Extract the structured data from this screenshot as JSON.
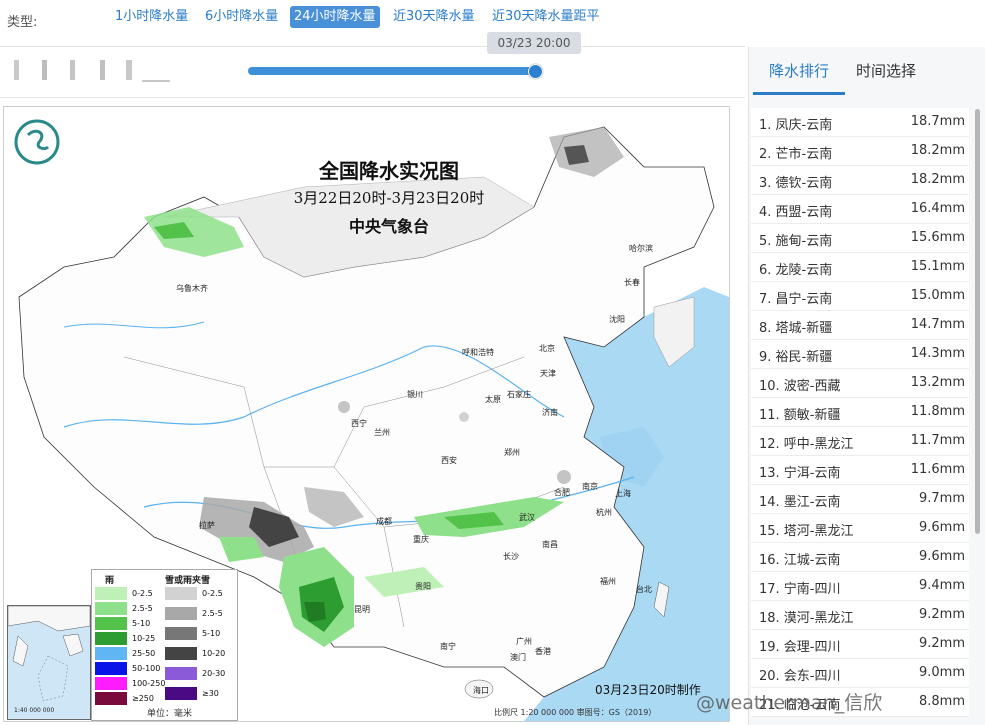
{
  "typebar": {
    "label": "类型:",
    "options": [
      {
        "label": "1小时降水量",
        "active": false
      },
      {
        "label": "6小时降水量",
        "active": false
      },
      {
        "label": "24小时降水量",
        "active": true
      },
      {
        "label": "近30天降水量",
        "active": false
      },
      {
        "label": "近30天降水量距平",
        "active": false
      }
    ]
  },
  "slider": {
    "time": "03/23 20:00"
  },
  "map": {
    "title": "全国降水实况图",
    "subtitle": "3月22日20时-3月23日20时",
    "org": "中央气象台",
    "date_stamp": "03月23日20时制作",
    "footer": "比例尺 1:20 000 000      审图号：GS（2019）",
    "inset_scale": "1:40 000 000",
    "cities": [
      "乌鲁木齐",
      "哈尔滨",
      "长春",
      "沈阳",
      "北京",
      "天津",
      "呼和浩特",
      "银川",
      "太原",
      "石家庄",
      "济南",
      "西宁",
      "兰州",
      "郑州",
      "西安",
      "拉萨",
      "成都",
      "重庆",
      "武汉",
      "合肥",
      "南京",
      "上海",
      "杭州",
      "长沙",
      "南昌",
      "贵阳",
      "昆明",
      "福州",
      "台北",
      "南宁",
      "广州",
      "香港",
      "澳门",
      "海口"
    ],
    "legend": {
      "rain_title": "雨",
      "snow_title": "雪或雨夹雪",
      "unit": "单位：毫米",
      "rain": [
        {
          "label": "0-2.5",
          "color": "#bff0b8"
        },
        {
          "label": "2.5-5",
          "color": "#8ee08a"
        },
        {
          "label": "5-10",
          "color": "#52c24a"
        },
        {
          "label": "10-25",
          "color": "#2e9d31"
        },
        {
          "label": "25-50",
          "color": "#5fb6f2"
        },
        {
          "label": "50-100",
          "color": "#0a14e8"
        },
        {
          "label": "100-250",
          "color": "#ff1cff"
        },
        {
          "label": "≥250",
          "color": "#7a0a3c"
        }
      ],
      "snow": [
        {
          "label": "0-2.5",
          "color": "#d2d2d2"
        },
        {
          "label": "2.5-5",
          "color": "#a8a8a8"
        },
        {
          "label": "5-10",
          "color": "#777777"
        },
        {
          "label": "10-20",
          "color": "#444444"
        },
        {
          "label": "20-30",
          "color": "#8a5ad8"
        },
        {
          "label": "≥30",
          "color": "#4a0a82"
        }
      ]
    },
    "watermark": "@weatherman_信欣"
  },
  "right_panel": {
    "tabs": [
      "降水排行",
      "时间选择"
    ],
    "ranking": [
      {
        "name": "1. 凤庆-云南",
        "value": "18.7mm"
      },
      {
        "name": "2. 芒市-云南",
        "value": "18.2mm"
      },
      {
        "name": "3. 德钦-云南",
        "value": "18.2mm"
      },
      {
        "name": "4. 西盟-云南",
        "value": "16.4mm"
      },
      {
        "name": "5. 施甸-云南",
        "value": "15.6mm"
      },
      {
        "name": "6. 龙陵-云南",
        "value": "15.1mm"
      },
      {
        "name": "7. 昌宁-云南",
        "value": "15.0mm"
      },
      {
        "name": "8. 塔城-新疆",
        "value": "14.7mm"
      },
      {
        "name": "9. 裕民-新疆",
        "value": "14.3mm"
      },
      {
        "name": "10. 波密-西藏",
        "value": "13.2mm"
      },
      {
        "name": "11. 额敏-新疆",
        "value": "11.8mm"
      },
      {
        "name": "12. 呼中-黑龙江",
        "value": "11.7mm"
      },
      {
        "name": "13. 宁洱-云南",
        "value": "11.6mm"
      },
      {
        "name": "14. 墨江-云南",
        "value": "9.7mm"
      },
      {
        "name": "15. 塔河-黑龙江",
        "value": "9.6mm"
      },
      {
        "name": "16. 江城-云南",
        "value": "9.6mm"
      },
      {
        "name": "17. 宁南-四川",
        "value": "9.4mm"
      },
      {
        "name": "18. 漠河-黑龙江",
        "value": "9.2mm"
      },
      {
        "name": "19. 会理-四川",
        "value": "9.2mm"
      },
      {
        "name": "20. 会东-四川",
        "value": "9.0mm"
      },
      {
        "name": "21. 临沧-云南",
        "value": "8.8mm"
      }
    ]
  }
}
